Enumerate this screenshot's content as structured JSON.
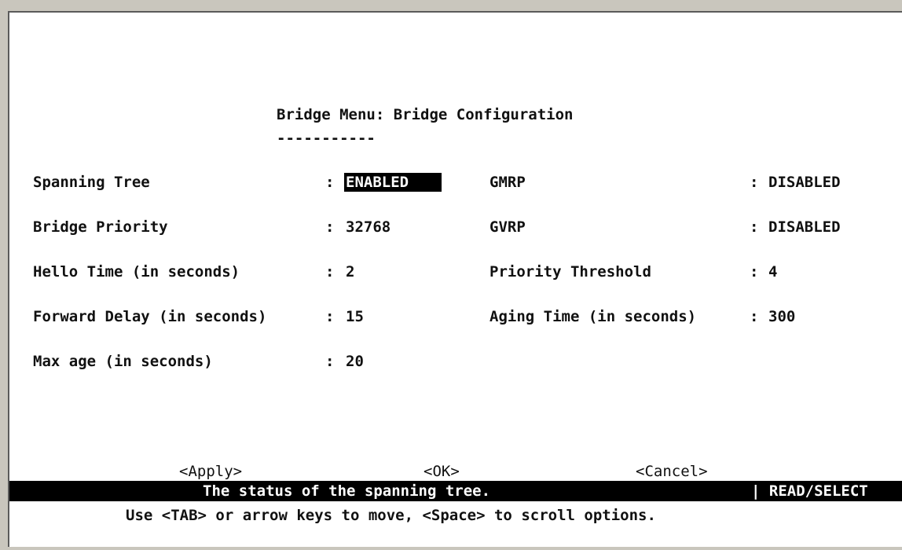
{
  "title": "Bridge Menu: Bridge Configuration",
  "title_underline": "-----------",
  "left_fields": [
    {
      "label": "Spanning Tree",
      "sep": ":",
      "value": "ENABLED"
    },
    {
      "label": "Bridge Priority",
      "sep": ":",
      "value": "32768"
    },
    {
      "label": "Hello Time (in seconds)",
      "sep": ":",
      "value": "2"
    },
    {
      "label": "Forward Delay (in seconds)",
      "sep": ":",
      "value": "15"
    },
    {
      "label": "Max age (in seconds)",
      "sep": ":",
      "value": "20"
    }
  ],
  "right_fields": [
    {
      "label": "GMRP",
      "sep": ":",
      "value": "DISABLED"
    },
    {
      "label": "GVRP",
      "sep": ":",
      "value": "DISABLED"
    },
    {
      "label": "Priority Threshold",
      "sep": ":",
      "value": "4"
    },
    {
      "label": "Aging Time (in seconds)",
      "sep": ":",
      "value": "300"
    }
  ],
  "buttons": {
    "apply": "<Apply>",
    "ok": "<OK>",
    "cancel": "<Cancel>"
  },
  "status": {
    "message": "The status of the spanning tree.",
    "mode": "| READ/SELECT"
  },
  "help": "Use <TAB> or arrow keys to move, <Space> to scroll options."
}
